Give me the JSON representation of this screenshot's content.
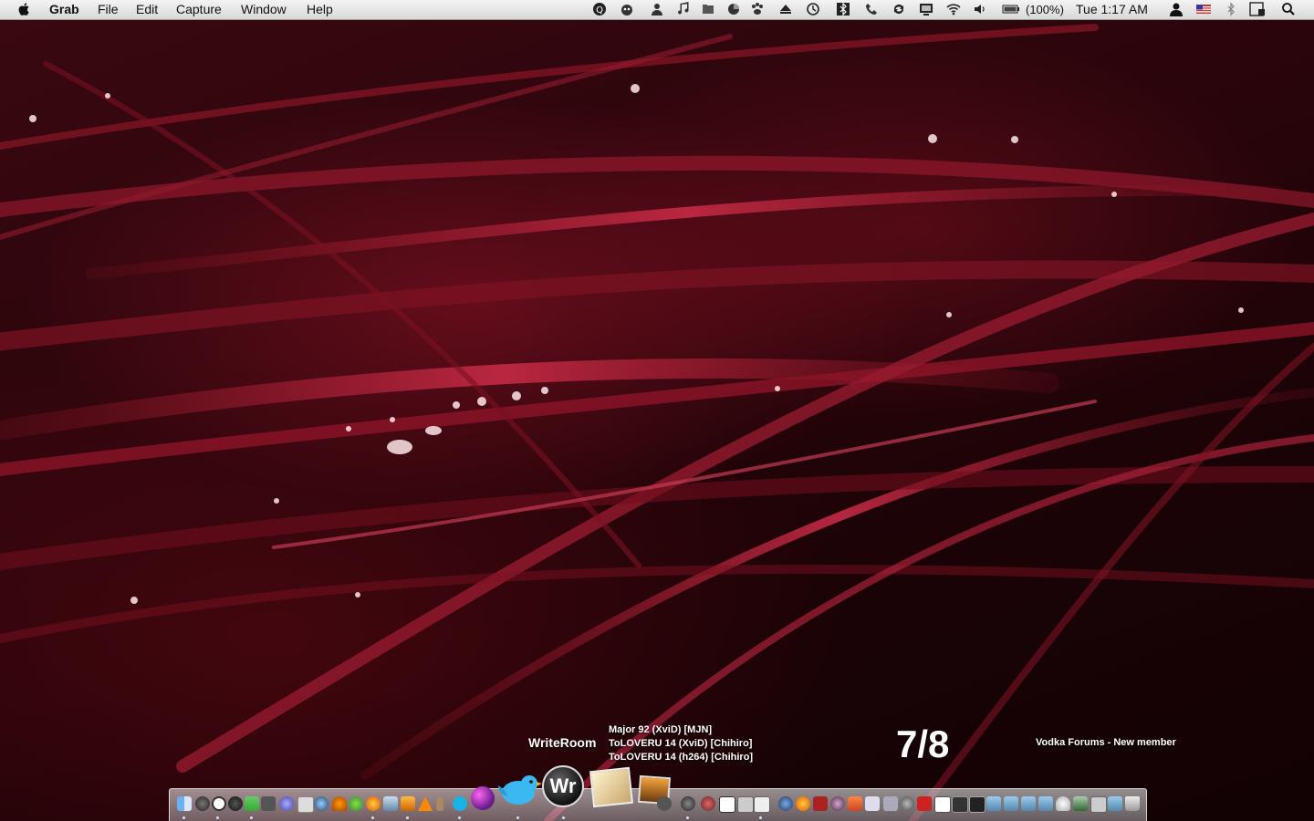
{
  "menubar": {
    "app_name": "Grab",
    "menus": [
      "File",
      "Edit",
      "Capture",
      "Window",
      "Help"
    ],
    "battery_text": "(100%)",
    "clock": "Tue 1:17 AM",
    "status_icons": [
      "quicksilver-icon",
      "growl-icon",
      "user-icon",
      "music-note-icon",
      "folder-icon",
      "menu-meter-icon",
      "paw-icon",
      "eject-icon",
      "time-machine-icon",
      "bluetooth-box-icon",
      "phone-icon",
      "sync-icon",
      "display-icon",
      "wifi-icon",
      "volume-icon",
      "battery-icon",
      "account-icon",
      "flag-us-icon",
      "bluetooth-icon",
      "calendar-icon",
      "spotlight-icon"
    ]
  },
  "widgets": {
    "writeroom_label": "WriteRoom",
    "downloads": [
      "Major 92 (XviD) [MJN]",
      "ToLOVERU 14 (XviD) [Chihiro]",
      "ToLOVERU 14 (h264) [Chihiro]"
    ],
    "counter": "7/8",
    "notification": "Vodka Forums - New member"
  },
  "dock": {
    "big_icon_label": "Wr",
    "colors": {
      "wallpaper": "#3a0810",
      "accent": "#c2203c"
    }
  }
}
